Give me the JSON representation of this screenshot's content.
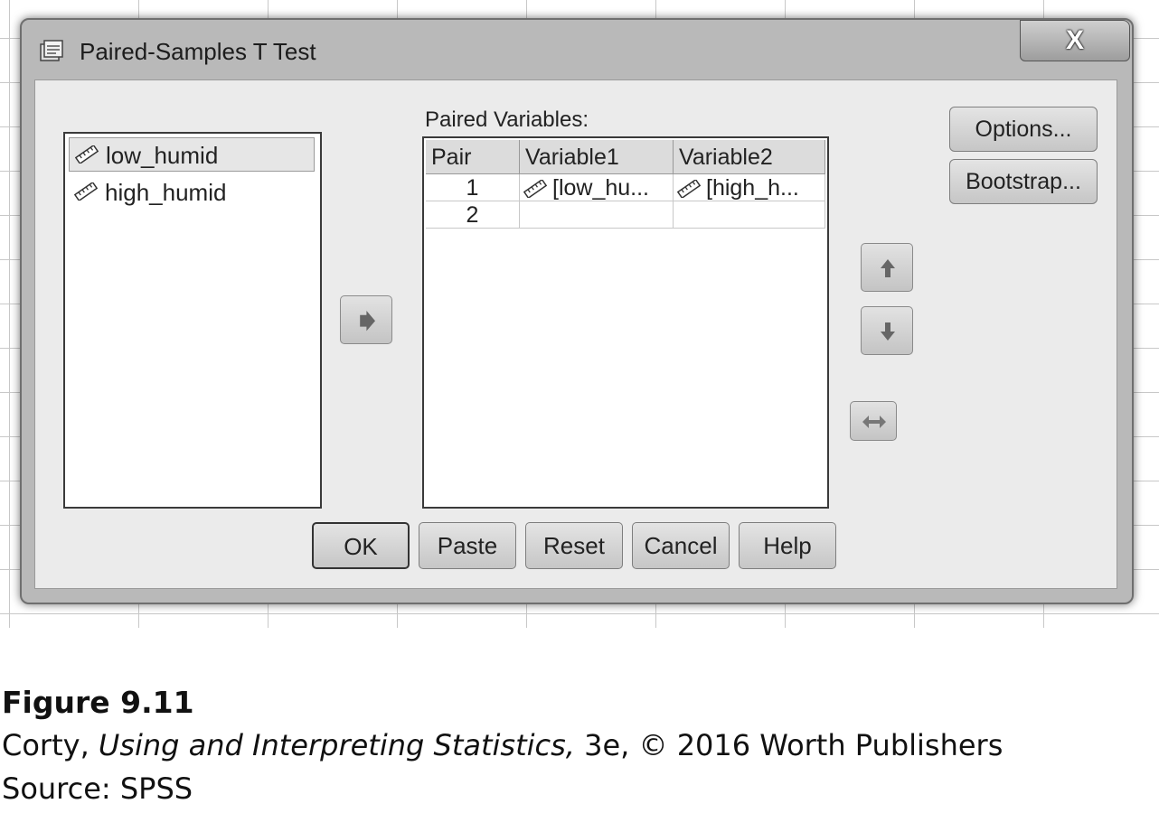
{
  "dialog": {
    "title": "Paired-Samples T Test",
    "close_label": "X",
    "title_icon": "spss-dialog-icon"
  },
  "variables": {
    "items": [
      {
        "label": "low_humid",
        "icon": "scale-ruler-icon",
        "selected": true
      },
      {
        "label": "high_humid",
        "icon": "scale-ruler-icon",
        "selected": false
      }
    ]
  },
  "paired_variables": {
    "label": "Paired Variables:",
    "columns": [
      "Pair",
      "Variable1",
      "Variable2"
    ],
    "rows": [
      {
        "pair": "1",
        "var1": "[low_hu...",
        "var2": "[high_h..."
      },
      {
        "pair": "2",
        "var1": "",
        "var2": ""
      }
    ]
  },
  "side_buttons": {
    "options": "Options...",
    "bootstrap": "Bootstrap..."
  },
  "buttons": {
    "ok": "OK",
    "paste": "Paste",
    "reset": "Reset",
    "cancel": "Cancel",
    "help": "Help"
  },
  "icons": {
    "move_right": "arrow-right-icon",
    "move_up": "arrow-up-icon",
    "move_down": "arrow-down-icon",
    "swap": "swap-icon"
  },
  "caption": {
    "figure": "Figure 9.11",
    "author": "Corty, ",
    "book": "Using and Interpreting Statistics,",
    "edition": " 3e, © 2016 Worth Publishers",
    "source": "Source: SPSS"
  }
}
